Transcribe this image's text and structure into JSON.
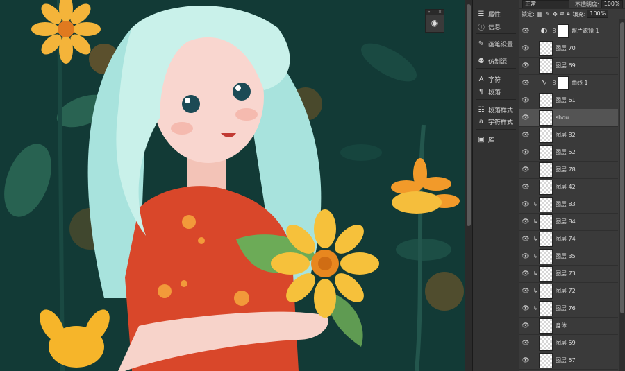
{
  "side_panel": {
    "items": [
      {
        "icon": "properties-icon",
        "glyph": "☰",
        "label": "属性"
      },
      {
        "icon": "info-icon",
        "glyph": "ⓘ",
        "label": "信息"
      },
      {
        "icon": "brush-settings-icon",
        "glyph": "✎",
        "label": "画笔设置"
      },
      {
        "icon": "clone-source-icon",
        "glyph": "⚉",
        "label": "仿制源"
      },
      {
        "icon": "character-icon",
        "glyph": "A",
        "label": "字符"
      },
      {
        "icon": "paragraph-icon",
        "glyph": "¶",
        "label": "段落"
      },
      {
        "icon": "paragraph-styles-icon",
        "glyph": "☷",
        "label": "段落样式"
      },
      {
        "icon": "character-styles-icon",
        "glyph": "a",
        "label": "字符样式"
      },
      {
        "icon": "library-icon",
        "glyph": "▣",
        "label": "库"
      }
    ]
  },
  "layers_panel": {
    "blend_mode": "正常",
    "opacity_label": "不透明度:",
    "opacity_value": "100%",
    "lock_label": "锁定:",
    "fill_label": "填充:",
    "fill_value": "100%",
    "layers": [
      {
        "name": "照片滤镜 1",
        "type": "adjustment",
        "glyph": "◐",
        "mask": true,
        "clipped": false,
        "selected": false
      },
      {
        "name": "图层 70",
        "type": "pixel",
        "clipped": false,
        "selected": false
      },
      {
        "name": "图层 69",
        "type": "pixel",
        "clipped": false,
        "selected": false
      },
      {
        "name": "曲线 1",
        "type": "adjustment",
        "glyph": "∿",
        "mask": true,
        "clipped": false,
        "selected": false
      },
      {
        "name": "图层 61",
        "type": "pixel",
        "clipped": false,
        "selected": false
      },
      {
        "name": "shou",
        "type": "pixel",
        "clipped": false,
        "selected": true
      },
      {
        "name": "图层 82",
        "type": "pixel",
        "clipped": false,
        "selected": false
      },
      {
        "name": "图层 52",
        "type": "pixel",
        "clipped": false,
        "selected": false
      },
      {
        "name": "图层 78",
        "type": "pixel",
        "clipped": false,
        "selected": false
      },
      {
        "name": "图层 42",
        "type": "pixel",
        "clipped": false,
        "selected": false
      },
      {
        "name": "图层 83",
        "type": "pixel",
        "clipped": true,
        "selected": false
      },
      {
        "name": "图层 84",
        "type": "pixel",
        "clipped": true,
        "selected": false
      },
      {
        "name": "图层 74",
        "type": "pixel",
        "clipped": true,
        "selected": false
      },
      {
        "name": "图层 35",
        "type": "pixel",
        "clipped": true,
        "selected": false
      },
      {
        "name": "图层 73",
        "type": "pixel",
        "clipped": true,
        "selected": false
      },
      {
        "name": "图层 72",
        "type": "pixel",
        "clipped": true,
        "selected": false
      },
      {
        "name": "图层 76",
        "type": "pixel",
        "clipped": true,
        "selected": false
      },
      {
        "name": "身体",
        "type": "pixel",
        "clipped": false,
        "selected": false
      },
      {
        "name": "图层 59",
        "type": "pixel",
        "clipped": false,
        "selected": false
      },
      {
        "name": "图层 57",
        "type": "pixel",
        "clipped": false,
        "selected": false
      }
    ]
  },
  "colors": {
    "canvas_bg": "#123a36",
    "hair": "#c9f1ea",
    "dress": "#d9472a",
    "sunflower": "#f6b52a"
  }
}
